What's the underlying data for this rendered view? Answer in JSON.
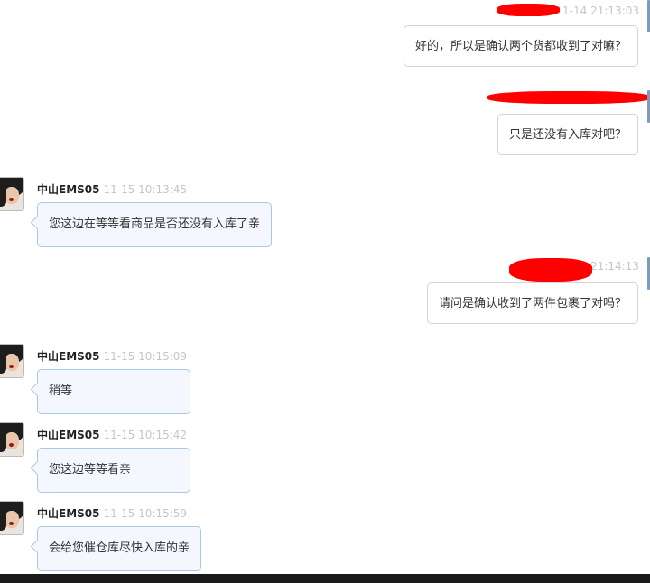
{
  "messages": [
    {
      "direction": "out",
      "time": "11-14 21:13:03",
      "text": "好的，所以是确认两个货都收到了对嘛？"
    },
    {
      "direction": "out",
      "time": "",
      "text": "只是还没有入库对吧？"
    },
    {
      "direction": "in",
      "sender": "中山EMS05",
      "time": "11-15 10:13:45",
      "text": "您这边在等等看商品是否还没有入库了亲"
    },
    {
      "direction": "out",
      "time": "21:14:13",
      "text": "请问是确认收到了两件包裹了对吗？"
    },
    {
      "direction": "in",
      "sender": "中山EMS05",
      "time": "11-15 10:15:09",
      "text": "稍等"
    },
    {
      "direction": "in",
      "sender": "中山EMS05",
      "time": "11-15 10:15:42",
      "text": "您这边等等看亲"
    },
    {
      "direction": "in",
      "sender": "中山EMS05",
      "time": "11-15 10:15:59",
      "text": "会给您催仓库尽快入库的亲"
    }
  ],
  "colors": {
    "incoming_bubble_bg": "#f4f8fe",
    "incoming_bubble_border": "#a8c8e8",
    "outgoing_bubble_border": "#d3d3d3",
    "timestamp": "#c6c6c6",
    "redaction": "#ff0000"
  }
}
